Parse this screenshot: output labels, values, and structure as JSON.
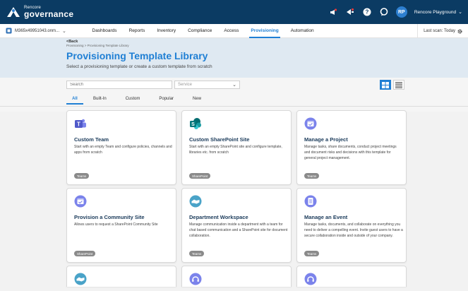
{
  "app": {
    "logo_small": "Rencore",
    "logo_big": "governance",
    "avatar_initials": "RP",
    "tenant_name": "Rencore Playground"
  },
  "nav": {
    "tenant_label": "M365x49951043.onm...",
    "tabs": [
      {
        "label": "Dashboards",
        "active": false
      },
      {
        "label": "Reports",
        "active": false
      },
      {
        "label": "Inventory",
        "active": false
      },
      {
        "label": "Compliance",
        "active": false
      },
      {
        "label": "Access",
        "active": false
      },
      {
        "label": "Provisioning",
        "active": true
      },
      {
        "label": "Automation",
        "active": false
      }
    ],
    "last_scan": "Last scan: Today"
  },
  "header": {
    "back_label": "<Back",
    "breadcrumb": "Provisioning > Provisioning Template Library",
    "title": "Provisioning Template Library",
    "subtitle": "Select a provisioning template or create a custom template from scratch"
  },
  "filters": {
    "search_placeholder": "Search",
    "service_placeholder": "Service",
    "tabs": [
      {
        "label": "All",
        "active": true
      },
      {
        "label": "Built-In",
        "active": false
      },
      {
        "label": "Custom",
        "active": false
      },
      {
        "label": "Popular",
        "active": false
      },
      {
        "label": "New",
        "active": false
      }
    ]
  },
  "colors": {
    "topbar": "#0b3b63",
    "accent": "#1f7fd4",
    "header_bg": "#dfe9f2",
    "teams": "#5059c9",
    "sharepoint": "#038387",
    "planner_icon": "#7b83eb"
  },
  "cards": [
    {
      "icon": "teams-icon",
      "title": "Custom Team",
      "description": "Start with an empty Team and configure policies, channels and apps from scratch",
      "badge": "Teams"
    },
    {
      "icon": "sharepoint-icon",
      "title": "Custom SharePoint Site",
      "description": "Start with an empty SharePoint site and configure template, libraries etc. from scratch",
      "badge": "SharePoint"
    },
    {
      "icon": "calendar-icon",
      "title": "Manage a Project",
      "description": "Manage tasks, share documents, conduct project meetings and document risks and decisions with this template for general project management.",
      "badge": "Teams"
    },
    {
      "icon": "calendar-icon",
      "title": "Provision a Community Site",
      "description": "Allows users to request a SharePoint Community Site",
      "badge": "SharePoint"
    },
    {
      "icon": "handshake-icon",
      "title": "Department Workspace",
      "description": "Manage communication inside a department with a team for chat based communication and a SharePoint site for document collaboration.",
      "badge": "Teams"
    },
    {
      "icon": "document-icon",
      "title": "Manage an Event",
      "description": "Manage tasks, documents, and collaborate on everything you need to deliver a compelling event. Invite guest users to have a secure collaboration inside and outside of your company.",
      "badge": "Teams"
    }
  ],
  "partial_cards": [
    {
      "icon": "handshake-icon"
    },
    {
      "icon": "headset-icon"
    },
    {
      "icon": "headset-icon"
    }
  ]
}
